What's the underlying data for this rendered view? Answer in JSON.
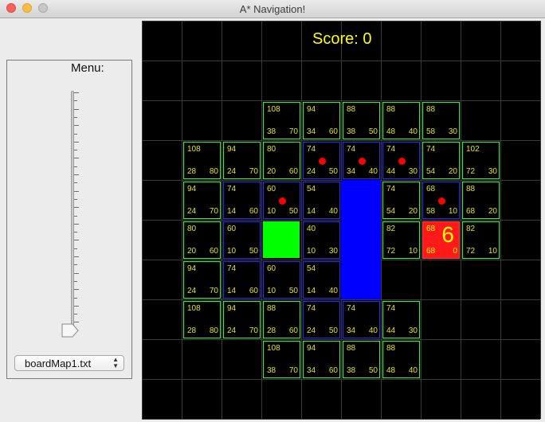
{
  "window": {
    "title": "A* Navigation!"
  },
  "menu": {
    "label": "Menu:",
    "slider_value": 0,
    "map_select": {
      "value": "boardMap1.txt"
    }
  },
  "game": {
    "score_label": "Score: 0",
    "colors": {
      "board_bg": "#000000",
      "grid": "#3a3a3a",
      "open_border": "#22ff22",
      "closed_border": "#2a2aff",
      "wall": "#0000ff",
      "start": "#00ff00",
      "target": "#ff1a1a",
      "text": "#e6e600",
      "path_dot": "#ff0000"
    },
    "start_cell": [
      3,
      5
    ],
    "walls": [
      [
        5,
        4
      ],
      [
        5,
        5
      ],
      [
        5,
        6
      ]
    ],
    "target": {
      "cell": [
        7,
        5
      ],
      "f": "68",
      "g": "68",
      "h": "0",
      "marker": "6"
    },
    "nodes": [
      {
        "c": 3,
        "r": 2,
        "t": "open",
        "f": "108",
        "g": "38",
        "h": "70"
      },
      {
        "c": 4,
        "r": 2,
        "t": "open",
        "f": "94",
        "g": "34",
        "h": "60"
      },
      {
        "c": 5,
        "r": 2,
        "t": "open",
        "f": "88",
        "g": "38",
        "h": "50"
      },
      {
        "c": 6,
        "r": 2,
        "t": "open",
        "f": "88",
        "g": "48",
        "h": "40"
      },
      {
        "c": 7,
        "r": 2,
        "t": "open",
        "f": "88",
        "g": "58",
        "h": "30"
      },
      {
        "c": 1,
        "r": 3,
        "t": "open",
        "f": "108",
        "g": "28",
        "h": "80"
      },
      {
        "c": 2,
        "r": 3,
        "t": "open",
        "f": "94",
        "g": "24",
        "h": "70"
      },
      {
        "c": 3,
        "r": 3,
        "t": "open",
        "f": "80",
        "g": "20",
        "h": "60"
      },
      {
        "c": 4,
        "r": 3,
        "t": "closed",
        "f": "74",
        "g": "24",
        "h": "50",
        "path": true
      },
      {
        "c": 5,
        "r": 3,
        "t": "closed",
        "f": "74",
        "g": "34",
        "h": "40",
        "path": true
      },
      {
        "c": 6,
        "r": 3,
        "t": "closed",
        "f": "74",
        "g": "44",
        "h": "30",
        "path": true
      },
      {
        "c": 7,
        "r": 3,
        "t": "open",
        "f": "74",
        "g": "54",
        "h": "20"
      },
      {
        "c": 8,
        "r": 3,
        "t": "open",
        "f": "102",
        "g": "72",
        "h": "30"
      },
      {
        "c": 1,
        "r": 4,
        "t": "open",
        "f": "94",
        "g": "24",
        "h": "70"
      },
      {
        "c": 2,
        "r": 4,
        "t": "closed",
        "f": "74",
        "g": "14",
        "h": "60"
      },
      {
        "c": 3,
        "r": 4,
        "t": "closed",
        "f": "60",
        "g": "10",
        "h": "50",
        "path": true
      },
      {
        "c": 4,
        "r": 4,
        "t": "closed",
        "f": "54",
        "g": "14",
        "h": "40"
      },
      {
        "c": 6,
        "r": 4,
        "t": "open",
        "f": "74",
        "g": "54",
        "h": "20"
      },
      {
        "c": 7,
        "r": 4,
        "t": "closed",
        "f": "68",
        "g": "58",
        "h": "10",
        "path": true
      },
      {
        "c": 8,
        "r": 4,
        "t": "open",
        "f": "88",
        "g": "68",
        "h": "20"
      },
      {
        "c": 1,
        "r": 5,
        "t": "open",
        "f": "80",
        "g": "20",
        "h": "60"
      },
      {
        "c": 2,
        "r": 5,
        "t": "closed",
        "f": "60",
        "g": "10",
        "h": "50"
      },
      {
        "c": 4,
        "r": 5,
        "t": "closed",
        "f": "40",
        "g": "10",
        "h": "30"
      },
      {
        "c": 6,
        "r": 5,
        "t": "open",
        "f": "82",
        "g": "72",
        "h": "10"
      },
      {
        "c": 8,
        "r": 5,
        "t": "open",
        "f": "82",
        "g": "72",
        "h": "10"
      },
      {
        "c": 1,
        "r": 6,
        "t": "open",
        "f": "94",
        "g": "24",
        "h": "70"
      },
      {
        "c": 2,
        "r": 6,
        "t": "closed",
        "f": "74",
        "g": "14",
        "h": "60"
      },
      {
        "c": 3,
        "r": 6,
        "t": "closed",
        "f": "60",
        "g": "10",
        "h": "50"
      },
      {
        "c": 4,
        "r": 6,
        "t": "closed",
        "f": "54",
        "g": "14",
        "h": "40"
      },
      {
        "c": 1,
        "r": 7,
        "t": "open",
        "f": "108",
        "g": "28",
        "h": "80"
      },
      {
        "c": 2,
        "r": 7,
        "t": "open",
        "f": "94",
        "g": "24",
        "h": "70"
      },
      {
        "c": 3,
        "r": 7,
        "t": "open",
        "f": "88",
        "g": "28",
        "h": "60"
      },
      {
        "c": 4,
        "r": 7,
        "t": "closed",
        "f": "74",
        "g": "24",
        "h": "50"
      },
      {
        "c": 5,
        "r": 7,
        "t": "closed",
        "f": "74",
        "g": "34",
        "h": "40"
      },
      {
        "c": 6,
        "r": 7,
        "t": "open",
        "f": "74",
        "g": "44",
        "h": "30"
      },
      {
        "c": 3,
        "r": 8,
        "t": "open",
        "f": "108",
        "g": "38",
        "h": "70"
      },
      {
        "c": 4,
        "r": 8,
        "t": "open",
        "f": "94",
        "g": "34",
        "h": "60"
      },
      {
        "c": 5,
        "r": 8,
        "t": "open",
        "f": "88",
        "g": "38",
        "h": "50"
      },
      {
        "c": 6,
        "r": 8,
        "t": "open",
        "f": "88",
        "g": "48",
        "h": "40"
      }
    ]
  }
}
